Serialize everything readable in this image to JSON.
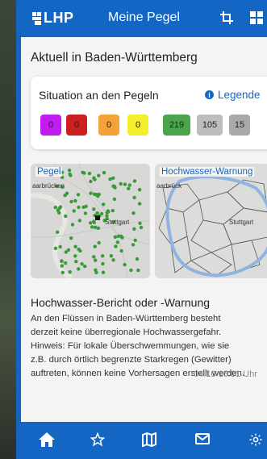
{
  "app": {
    "logo": "LHP",
    "title": "Meine Pegel"
  },
  "page": {
    "heading": "Aktuell in Baden-Württemberg"
  },
  "situation": {
    "title": "Situation an den Pegeln",
    "legend_label": "Legende",
    "chips": [
      {
        "value": "0",
        "color": "#c21cf2"
      },
      {
        "value": "0",
        "color": "#cc1f1f"
      },
      {
        "value": "0",
        "color": "#f4a238"
      },
      {
        "value": "0",
        "color": "#f5ee2c"
      },
      {
        "value": "219",
        "color": "#4ba54c"
      },
      {
        "value": "105",
        "color": "#bdbdbd"
      },
      {
        "value": "15",
        "color": "#a9a9a9"
      }
    ]
  },
  "tiles": {
    "pegel": {
      "label": "Pegel",
      "towns": [
        "aarbrücken",
        "Stuttgart"
      ]
    },
    "warnung": {
      "label": "Hochwasser-Warnung",
      "towns": [
        "aarbrück",
        "Stuttgart"
      ]
    }
  },
  "report": {
    "title": "Hochwasser-Bericht oder -Warnung",
    "lines": [
      "An den Flüssen in Baden-Württemberg besteht",
      "derzeit keine überregionale Hochwassergefahr.",
      "Hinweis: Für lokale Überschwemmungen, wie sie",
      "z.B. durch örtlich begrenzte Starkregen (Gewitter)",
      "auftreten, können keine Vorhersagen erstellt werden."
    ],
    "timestamp": "04.10 16:01 Uhr"
  },
  "nav": {
    "items": [
      "home-icon",
      "star-icon",
      "map-icon",
      "mail-icon",
      "settings-icon"
    ]
  },
  "colors": {
    "brand": "#1466c4",
    "background": "#f4f4f4"
  }
}
